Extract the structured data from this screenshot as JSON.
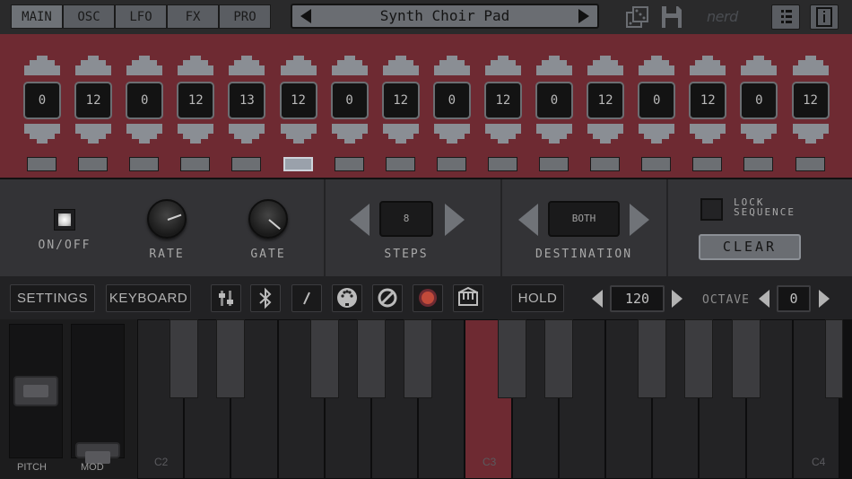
{
  "tabs": [
    {
      "label": "MAIN"
    },
    {
      "label": "OSC"
    },
    {
      "label": "LFO"
    },
    {
      "label": "FX"
    },
    {
      "label": "PRO"
    }
  ],
  "preset": {
    "name": "Synth Choir Pad"
  },
  "brand": "nerd",
  "icons": {
    "prev": "left-arrow-icon",
    "next": "right-arrow-icon",
    "random": "dice-icon",
    "save": "save-icon",
    "list": "list-icon",
    "info": "info-icon"
  },
  "sequencer": {
    "steps": [
      "0",
      "12",
      "0",
      "12",
      "13",
      "12",
      "0",
      "12",
      "0",
      "12",
      "0",
      "12",
      "0",
      "12",
      "0",
      "12"
    ],
    "active_step": 6
  },
  "controls": {
    "onoff_label": "ON/OFF",
    "onoff_state": true,
    "rate_label": "RATE",
    "gate_label": "GATE",
    "steps_label": "STEPS",
    "steps_value": "8",
    "destination_label": "DESTINATION",
    "destination_value": "BOTH",
    "lock_label_1": "LOCK",
    "lock_label_2": "SEQUENCE",
    "clear_label": "CLEAR"
  },
  "toolbar": {
    "settings": "SETTINGS",
    "keyboard": "KEYBOARD",
    "hold": "HOLD",
    "tempo": "120",
    "octave_label": "OCTAVE",
    "octave": "0"
  },
  "wheels": {
    "pitch": "PITCH",
    "mod": "MOD"
  },
  "keyboard": {
    "labels": [
      "C2",
      "C3",
      "C4"
    ],
    "pressed_key": "C3"
  },
  "colors": {
    "accent": "#6e2a32",
    "panel": "#333336"
  }
}
